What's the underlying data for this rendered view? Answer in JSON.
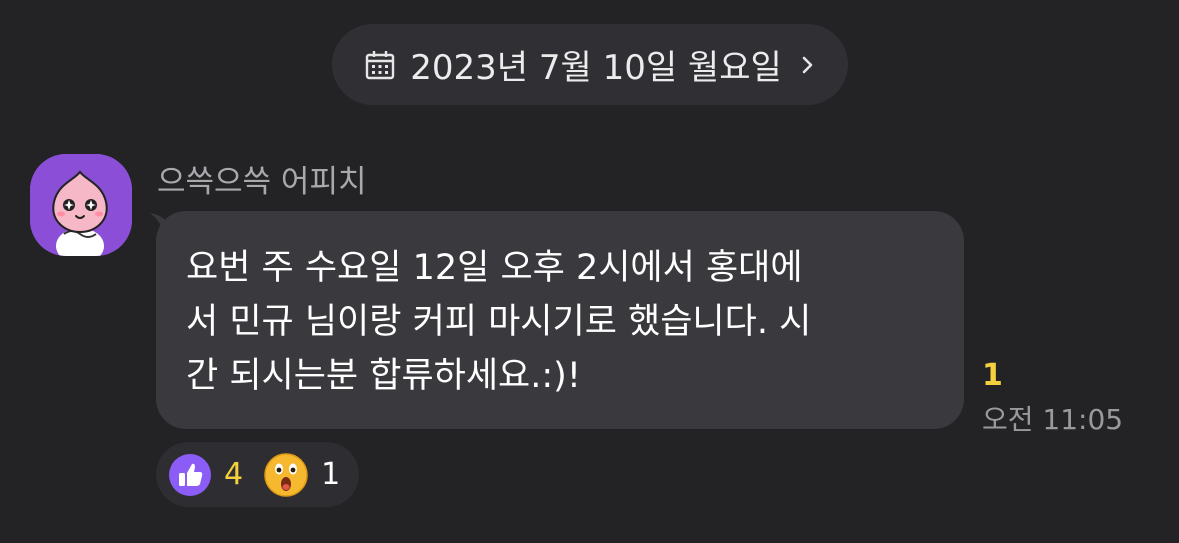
{
  "date_bar": {
    "icon": "calendar-icon",
    "text": "2023년 7월 10일 월요일",
    "chevron": "chevron-right-icon"
  },
  "message": {
    "sender": "으쓱으쓱 어피치",
    "text": "요번 주 수요일 12일 오후 2시에서 홍대에\n서 민규 님이랑 커피 마시기로 했습니다. 시\n간 되시는분 합류하세요.:)!",
    "unread_count": "1",
    "time": "오전 11:05",
    "avatar": "apeach-avatar"
  },
  "reactions": [
    {
      "icon": "thumbs-up-icon",
      "count": "4",
      "color": "#8b5cf6"
    },
    {
      "icon": "surprised-face-icon",
      "count": "1",
      "color": "#f5b82e"
    }
  ],
  "colors": {
    "background": "#232326",
    "bubble": "#3a3a3e",
    "accent_yellow": "#f4d03f",
    "avatar_bg": "#8a4fd6"
  }
}
